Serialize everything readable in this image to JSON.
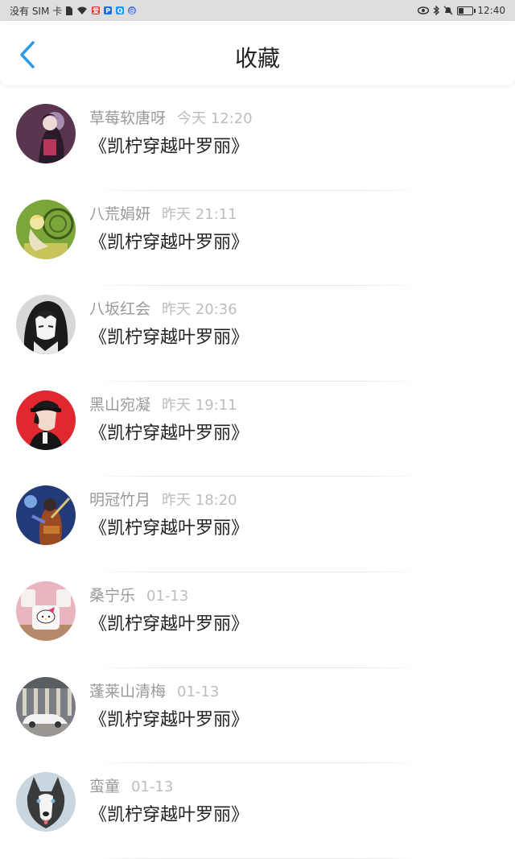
{
  "status_bar": {
    "carrier": "没有 SIM 卡",
    "time": "12:40",
    "battery_level": 0.3,
    "left_icons": [
      "sim-icon",
      "wifi-icon",
      "app-notification-icon",
      "app-notification-icon",
      "app-notification-icon",
      "app-notification-icon"
    ],
    "right_icons": [
      "eye-icon",
      "bluetooth-icon",
      "mute-icon",
      "battery-icon"
    ]
  },
  "header": {
    "title": "收藏",
    "back_icon": "chevron-left-icon",
    "accent_color": "#2b9ae8"
  },
  "favorites": [
    {
      "author": "草莓软唐呀",
      "time": "今天 12:20",
      "title": "《凯柠穿越叶罗丽》",
      "avatar_color": "#5a3550"
    },
    {
      "author": "八荒娟妍",
      "time": "昨天 21:11",
      "title": "《凯柠穿越叶罗丽》",
      "avatar_color": "#7aa63a"
    },
    {
      "author": "八坂红会",
      "time": "昨天 20:36",
      "title": "《凯柠穿越叶罗丽》",
      "avatar_color": "#d8d8d8"
    },
    {
      "author": "黑山宛凝",
      "time": "昨天 19:11",
      "title": "《凯柠穿越叶罗丽》",
      "avatar_color": "#e0282e"
    },
    {
      "author": "明冠竹月",
      "time": "昨天 18:20",
      "title": "《凯柠穿越叶罗丽》",
      "avatar_color": "#233a78"
    },
    {
      "author": "桑宁乐",
      "time": "01-13",
      "title": "《凯柠穿越叶罗丽》",
      "avatar_color": "#e9b6bf"
    },
    {
      "author": "蓬莱山清梅",
      "time": "01-13",
      "title": "《凯柠穿越叶罗丽》",
      "avatar_color": "#7a7e84"
    },
    {
      "author": "蛮童",
      "time": "01-13",
      "title": "《凯柠穿越叶罗丽》",
      "avatar_color": "#c9d6e0"
    }
  ]
}
